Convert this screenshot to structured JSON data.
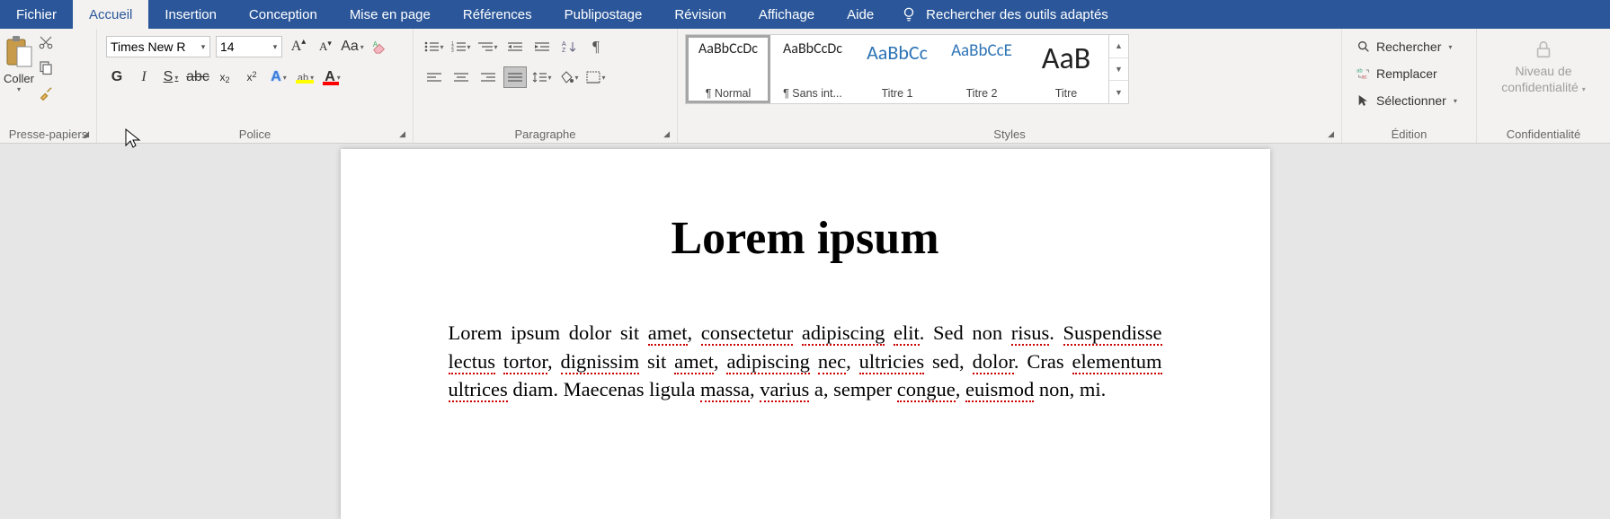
{
  "menubar": {
    "tabs": [
      {
        "label": "Fichier"
      },
      {
        "label": "Accueil"
      },
      {
        "label": "Insertion"
      },
      {
        "label": "Conception"
      },
      {
        "label": "Mise en page"
      },
      {
        "label": "Références"
      },
      {
        "label": "Publipostage"
      },
      {
        "label": "Révision"
      },
      {
        "label": "Affichage"
      },
      {
        "label": "Aide"
      }
    ],
    "search_placeholder": "Rechercher des outils adaptés"
  },
  "ribbon": {
    "clipboard": {
      "label": "Presse-papiers",
      "paste": "Coller"
    },
    "font": {
      "label": "Police",
      "name": "Times New R",
      "size": "14",
      "aa": "Aa",
      "bold": "G",
      "italic": "I",
      "under": "S",
      "strike": "abc",
      "sub": "x₂",
      "sup": "x²"
    },
    "paragraph": {
      "label": "Paragraphe"
    },
    "styles": {
      "label": "Styles",
      "items": [
        {
          "sample": "AaBbCcDc",
          "name": "¶ Normal",
          "color": "#222",
          "size": "16px"
        },
        {
          "sample": "AaBbCcDc",
          "name": "¶ Sans int...",
          "color": "#222",
          "size": "16px"
        },
        {
          "sample": "AaBbCc",
          "name": "Titre 1",
          "color": "#2e74b5",
          "size": "22px"
        },
        {
          "sample": "AaBbCcE",
          "name": "Titre 2",
          "color": "#2e74b5",
          "size": "19px"
        },
        {
          "sample": "AaB",
          "name": "Titre",
          "color": "#222",
          "size": "34px"
        }
      ]
    },
    "editing": {
      "label": "Édition",
      "find": "Rechercher",
      "replace": "Remplacer",
      "select": "Sélectionner"
    },
    "confidentiality": {
      "label": "Confidentialité",
      "line1": "Niveau de",
      "line2": "confidentialité"
    }
  },
  "document": {
    "title": "Lorem ipsum",
    "body_html": "Lorem ipsum dolor sit <span class='spellwave'>amet</span>, <span class='spellwave'>consectetur</span> <span class='spellwave'>adipiscing</span> <span class='spellwave'>elit</span>. Sed non <span class='spellwave'>risus</span>. <span class='spellwave'>Suspendisse</span> <span class='spellwave'>lectus</span> <span class='spellwave'>tortor</span>, <span class='spellwave'>dignissim</span> sit <span class='spellwave'>amet</span>, <span class='spellwave'>adipiscing</span> <span class='spellwave'>nec</span>, <span class='spellwave'>ultricies</span> sed, <span class='spellwave'>dolor</span>. Cras <span class='spellwave'>elementum</span> <span class='spellwave'>ultrices</span> diam. Maecenas ligula <span class='spellwave'>massa</span>, <span class='spellwave'>varius</span> a, semper <span class='spellwave'>congue</span>, <span class='spellwave'>euismod</span> non, mi."
  }
}
